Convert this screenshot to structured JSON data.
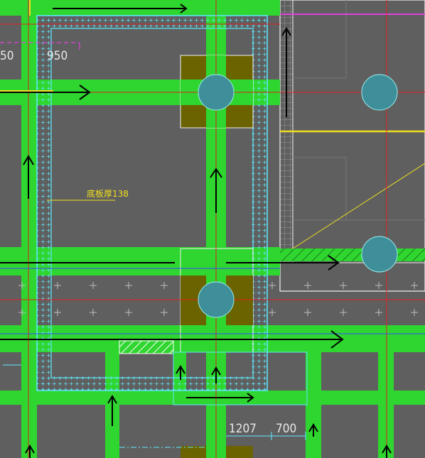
{
  "colors": {
    "background": "#5f5f5f",
    "beam": "#2fd62f",
    "column_fill": "#6b6200",
    "pile": "#3f8f9a",
    "cyan": "#5fe8ff",
    "red": "#e02020",
    "yellow": "#f0e020",
    "magenta": "#e040e0",
    "white": "#f2f2f2",
    "black": "#000000"
  },
  "labels": {
    "dim_left_partial": "50",
    "dim_top": "950",
    "dim_bottom_1": "1207",
    "dim_bottom_2": "700",
    "room_label": "底板厚138"
  }
}
